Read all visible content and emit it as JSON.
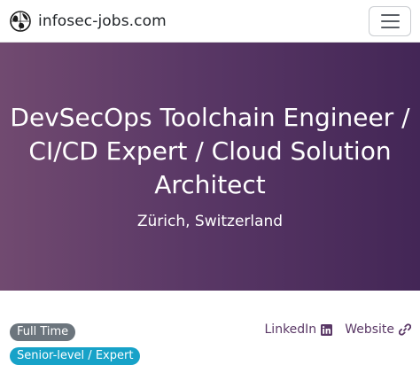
{
  "navbar": {
    "brand_text": "infosec-jobs.com",
    "logo_icon": "infosec-logo-icon",
    "menu_icon": "hamburger-menu-icon"
  },
  "hero": {
    "title": "DevSecOps Toolchain Engineer / CI/CD Expert / Cloud Solution Architect",
    "location": "Zürich, Switzerland"
  },
  "badges": {
    "employment_type": "Full Time",
    "level": "Senior-level / Expert"
  },
  "links": {
    "linkedin_label": "LinkedIn",
    "linkedin_icon": "linkedin-icon",
    "website_label": "Website",
    "website_icon": "link-icon"
  },
  "colors": {
    "hero_gradient_start": "#714a70",
    "hero_gradient_end": "#432656",
    "link_color": "#5a3866",
    "badge_secondary": "#6c757d",
    "badge_info": "#17a2c8"
  }
}
